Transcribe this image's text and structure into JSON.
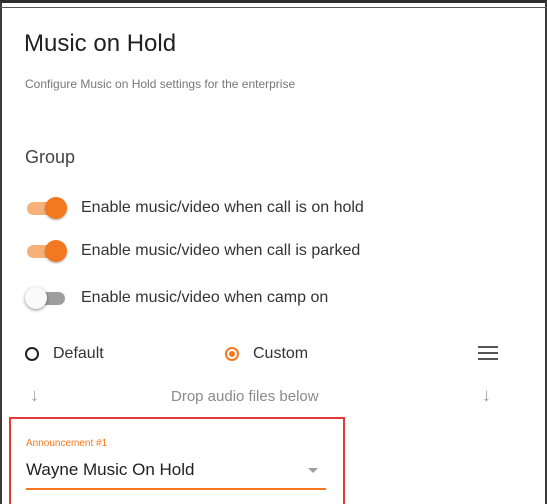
{
  "page": {
    "title": "Music on Hold",
    "subtitle": "Configure Music on Hold settings for the enterprise"
  },
  "group": {
    "label": "Group",
    "toggles": [
      {
        "label": "Enable music/video when call is on hold",
        "on": true
      },
      {
        "label": "Enable music/video when call is parked",
        "on": true
      },
      {
        "label": "Enable music/video when camp on",
        "on": false
      }
    ]
  },
  "source": {
    "options": [
      {
        "label": "Default",
        "selected": false
      },
      {
        "label": "Custom",
        "selected": true
      }
    ],
    "menu_icon": "menu-icon"
  },
  "drop": {
    "text": "Drop audio files below",
    "icon": "arrow-down-icon"
  },
  "announcement": {
    "label": "Announcement #1",
    "value": "Wayne Music On Hold"
  },
  "colors": {
    "accent": "#f4781f",
    "highlight_border": "#e53935"
  }
}
